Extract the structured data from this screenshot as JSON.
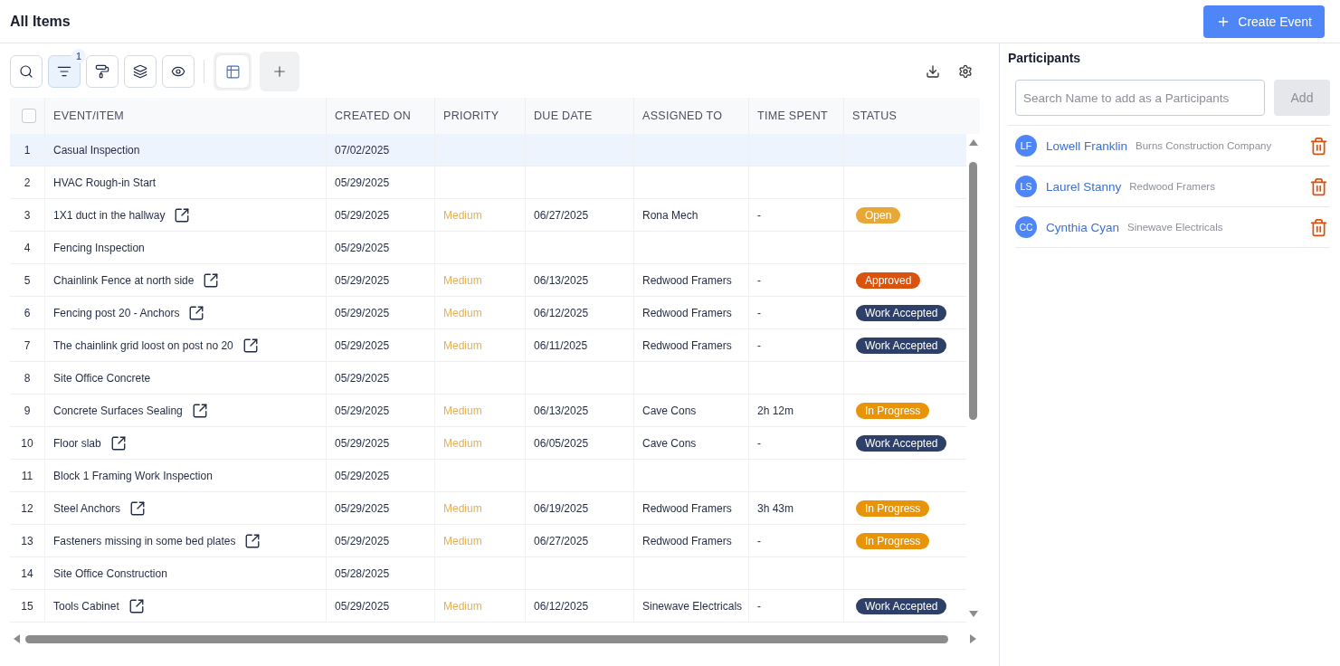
{
  "header": {
    "title": "All Items",
    "create_button": "Create Event"
  },
  "toolbar": {
    "tools": [
      {
        "kind": "search",
        "selected": false
      },
      {
        "kind": "filter",
        "selected": true,
        "badge": "1"
      },
      {
        "kind": "paint",
        "selected": false
      },
      {
        "kind": "layers",
        "selected": false
      },
      {
        "kind": "eye",
        "selected": false
      }
    ],
    "views": [
      {
        "kind": "table",
        "selected": true
      },
      {
        "kind": "add",
        "selected": false
      }
    ],
    "actions": [
      {
        "kind": "download"
      },
      {
        "kind": "settings"
      }
    ]
  },
  "table": {
    "select_all_checked": false,
    "columns": [
      "EVENT/ITEM",
      "CREATED ON",
      "PRIORITY",
      "DUE DATE",
      "ASSIGNED TO",
      "TIME SPENT",
      "STATUS"
    ],
    "rows": [
      {
        "index": "1",
        "event": "Casual Inspection",
        "linked": false,
        "created": "07/02/2025",
        "priority": "",
        "due": "",
        "assigned": "",
        "time": "",
        "status": null,
        "selected": true
      },
      {
        "index": "2",
        "event": "HVAC Rough-in Start",
        "linked": false,
        "created": "05/29/2025",
        "priority": "",
        "due": "",
        "assigned": "",
        "time": "",
        "status": null,
        "selected": false
      },
      {
        "index": "3",
        "event": "1X1 duct in the hallway",
        "linked": true,
        "created": "05/29/2025",
        "priority": "Medium",
        "due": "06/27/2025",
        "assigned": "Rona Mech",
        "time": "-",
        "status": {
          "label": "Open",
          "color": "#e8a838"
        },
        "selected": false
      },
      {
        "index": "4",
        "event": "Fencing Inspection",
        "linked": false,
        "created": "05/29/2025",
        "priority": "",
        "due": "",
        "assigned": "",
        "time": "",
        "status": null,
        "selected": false
      },
      {
        "index": "5",
        "event": "Chainlink Fence at north side",
        "linked": true,
        "created": "05/29/2025",
        "priority": "Medium",
        "due": "06/13/2025",
        "assigned": "Redwood Framers",
        "time": "-",
        "status": {
          "label": "Approved",
          "color": "#d9530f"
        },
        "selected": false
      },
      {
        "index": "6",
        "event": "Fencing post 20 - Anchors",
        "linked": true,
        "created": "05/29/2025",
        "priority": "Medium",
        "due": "06/12/2025",
        "assigned": "Redwood Framers",
        "time": "-",
        "status": {
          "label": "Work Accepted",
          "color": "#2e4068"
        },
        "selected": false
      },
      {
        "index": "7",
        "event": "The chainlink grid loost on post no 20",
        "linked": true,
        "created": "05/29/2025",
        "priority": "Medium",
        "due": "06/11/2025",
        "assigned": "Redwood Framers",
        "time": "-",
        "status": {
          "label": "Work Accepted",
          "color": "#2e4068"
        },
        "selected": false
      },
      {
        "index": "8",
        "event": "Site Office Concrete",
        "linked": false,
        "created": "05/29/2025",
        "priority": "",
        "due": "",
        "assigned": "",
        "time": "",
        "status": null,
        "selected": false
      },
      {
        "index": "9",
        "event": "Concrete Surfaces Sealing",
        "linked": true,
        "created": "05/29/2025",
        "priority": "Medium",
        "due": "06/13/2025",
        "assigned": "Cave Cons",
        "time": "2h 12m",
        "status": {
          "label": "In Progress",
          "color": "#e8940a"
        },
        "selected": false
      },
      {
        "index": "10",
        "event": "Floor slab",
        "linked": true,
        "created": "05/29/2025",
        "priority": "Medium",
        "due": "06/05/2025",
        "assigned": "Cave Cons",
        "time": "-",
        "status": {
          "label": "Work Accepted",
          "color": "#2e4068"
        },
        "selected": false
      },
      {
        "index": "11",
        "event": "Block 1 Framing Work Inspection",
        "linked": false,
        "created": "05/29/2025",
        "priority": "",
        "due": "",
        "assigned": "",
        "time": "",
        "status": null,
        "selected": false
      },
      {
        "index": "12",
        "event": "Steel Anchors",
        "linked": true,
        "created": "05/29/2025",
        "priority": "Medium",
        "due": "06/19/2025",
        "assigned": "Redwood Framers",
        "time": "3h 43m",
        "status": {
          "label": "In Progress",
          "color": "#e8940a"
        },
        "selected": false
      },
      {
        "index": "13",
        "event": "Fasteners missing in some bed plates",
        "linked": true,
        "created": "05/29/2025",
        "priority": "Medium",
        "due": "06/27/2025",
        "assigned": "Redwood Framers",
        "time": "-",
        "status": {
          "label": "In Progress",
          "color": "#e8940a"
        },
        "selected": false
      },
      {
        "index": "14",
        "event": "Site Office Construction",
        "linked": false,
        "created": "05/28/2025",
        "priority": "",
        "due": "",
        "assigned": "",
        "time": "",
        "status": null,
        "selected": false
      },
      {
        "index": "15",
        "event": "Tools Cabinet",
        "linked": true,
        "created": "05/29/2025",
        "priority": "Medium",
        "due": "06/12/2025",
        "assigned": "Sinewave Electricals",
        "time": "-",
        "status": {
          "label": "Work Accepted",
          "color": "#2e4068"
        },
        "selected": false
      }
    ]
  },
  "participants": {
    "title": "Participants",
    "search": {
      "placeholder": "Search Name to add as a Participants"
    },
    "add_button": {
      "label": "Add",
      "disabled": true
    },
    "people": [
      {
        "initials": "LF",
        "name": "Lowell Franklin",
        "company": "Burns Construction Company"
      },
      {
        "initials": "LS",
        "name": "Laurel Stanny",
        "company": "Redwood Framers"
      },
      {
        "initials": "CC",
        "name": "Cynthia Cyan",
        "company": "Sinewave Electricals"
      }
    ]
  }
}
